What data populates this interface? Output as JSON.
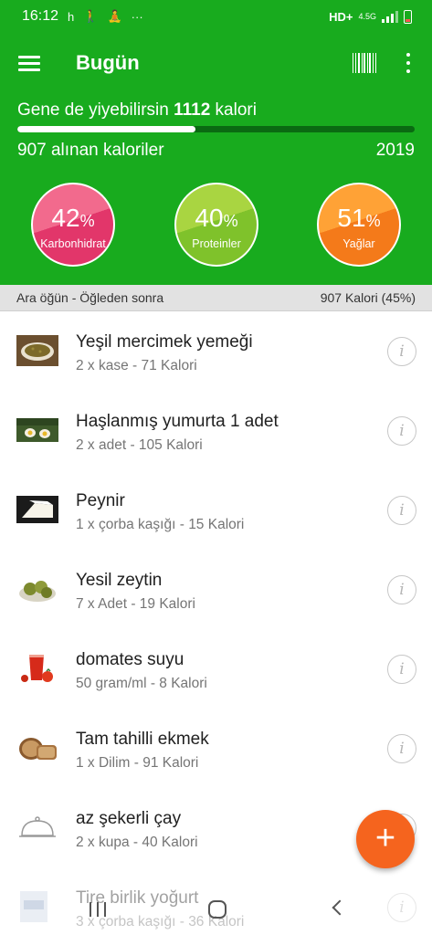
{
  "status_bar": {
    "time": "16:12",
    "glyphs": [
      "h",
      "🚶",
      "🧘",
      "···"
    ],
    "network": "HD+",
    "network_type": "4.5G"
  },
  "app_bar": {
    "title": "Bugün",
    "icons": [
      "menu-icon",
      "barcode-icon",
      "more-vert-icon"
    ]
  },
  "summary": {
    "remaining_prefix": "Gene de yiyebilirsin",
    "remaining_value": "1112",
    "remaining_suffix": "kalori",
    "consumed_label": "907 alınan kaloriler",
    "goal": "2019",
    "progress": 0.449
  },
  "macros": [
    {
      "value": "42",
      "unit": "%",
      "label": "Karbonhidrat",
      "color": "#e2366a"
    },
    {
      "value": "40",
      "unit": "%",
      "label": "Proteinler",
      "color": "#7fc22b"
    },
    {
      "value": "51",
      "unit": "%",
      "label": "Yağlar",
      "color": "#f47a1a"
    }
  ],
  "meal": {
    "title": "Ara öğün - Öğleden sonra",
    "total": "907 Kalori (45%)"
  },
  "foods": [
    {
      "name": "Yeşil mercimek yemeği",
      "detail": "2 x kase - 71 Kalori",
      "thumb": "lentil-soup"
    },
    {
      "name": "Haşlanmış yumurta 1 adet",
      "detail": "2 x adet - 105 Kalori",
      "thumb": "boiled-egg"
    },
    {
      "name": "Peynir",
      "detail": "1 x çorba kaşığı - 15 Kalori",
      "thumb": "cheese"
    },
    {
      "name": "Yesil zeytin",
      "detail": "7 x Adet - 19 Kalori",
      "thumb": "green-olives"
    },
    {
      "name": "domates suyu",
      "detail": "50 gram/ml - 8 Kalori",
      "thumb": "tomato-juice"
    },
    {
      "name": "Tam tahilli ekmek",
      "detail": "1 x Dilim - 91 Kalori",
      "thumb": "whole-grain-bread"
    },
    {
      "name": "az şekerli çay",
      "detail": "2 x kupa - 40 Kalori",
      "thumb": "generic-dish"
    },
    {
      "name": "Tire birlik yoğurt",
      "detail": "3 x çorba kaşığı - 36 Kalori",
      "thumb": "yogurt"
    }
  ],
  "info_glyph": "i",
  "fab": {
    "label": "+"
  },
  "colors": {
    "primary": "#18ab1e",
    "accent": "#f5641e",
    "progress_track": "#0a6a12"
  }
}
